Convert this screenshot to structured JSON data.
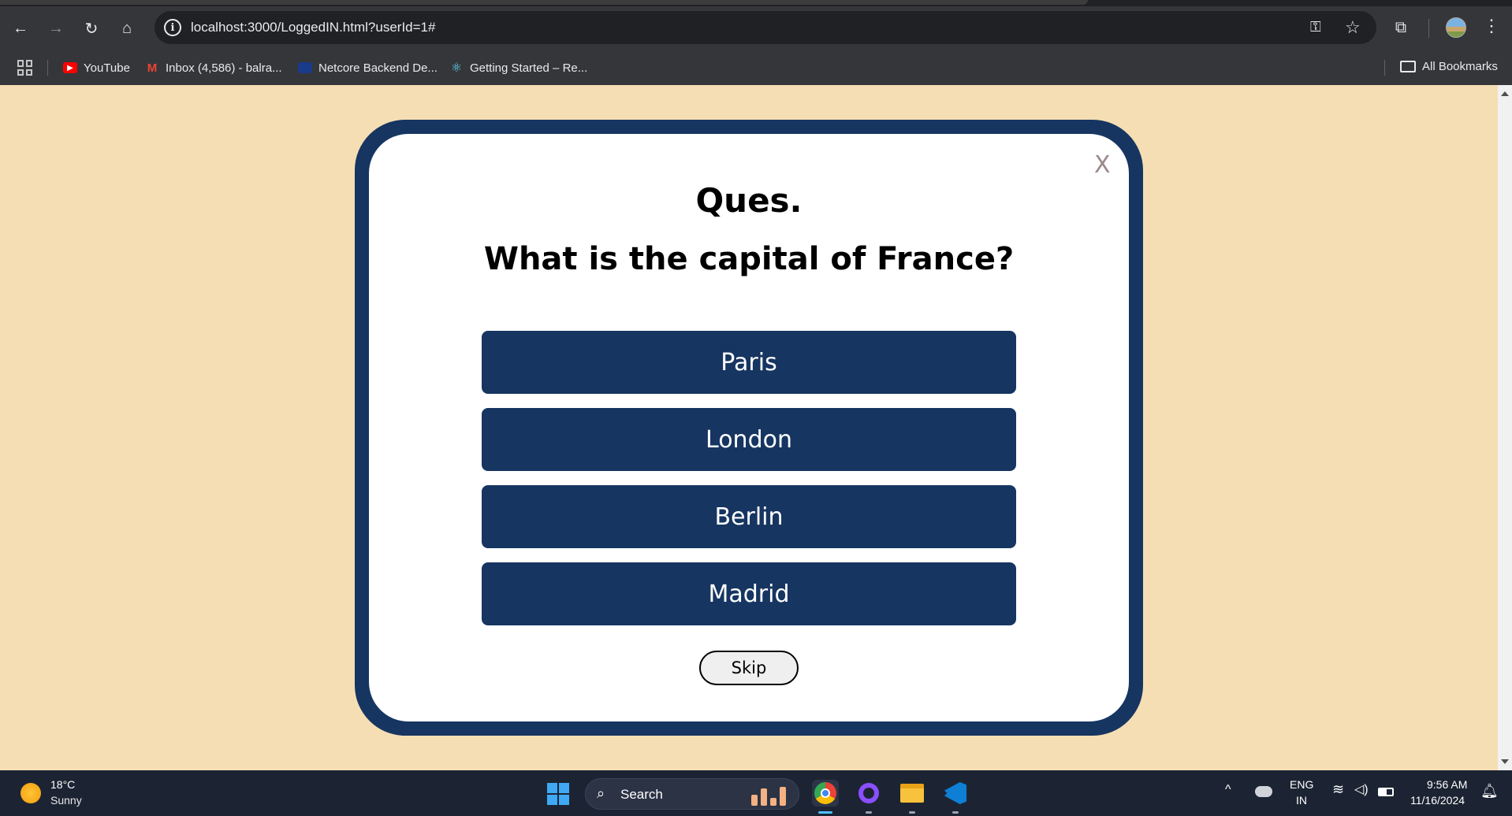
{
  "browser": {
    "url": "localhost:3000/LoggedIN.html?userId=1#",
    "bookmarks": [
      {
        "label": "YouTube",
        "icon": "youtube-icon"
      },
      {
        "label": "Inbox (4,586) - balra...",
        "icon": "gmail-icon"
      },
      {
        "label": "Netcore Backend De...",
        "icon": "netcore-icon"
      },
      {
        "label": "Getting Started – Re...",
        "icon": "react-icon"
      }
    ],
    "all_bookmarks": "All Bookmarks"
  },
  "quiz": {
    "close_label": "X",
    "ques_label": "Ques.",
    "question": "What is the capital of France?",
    "options": [
      "Paris",
      "London",
      "Berlin",
      "Madrid"
    ],
    "skip_label": "Skip",
    "colors": {
      "background": "#f5deb3",
      "card_border": "#163561",
      "option_bg": "#163561"
    }
  },
  "taskbar": {
    "temperature": "18°C",
    "condition": "Sunny",
    "search_label": "Search",
    "lang_top": "ENG",
    "lang_bottom": "IN",
    "time": "9:56 AM",
    "date": "11/16/2024"
  }
}
